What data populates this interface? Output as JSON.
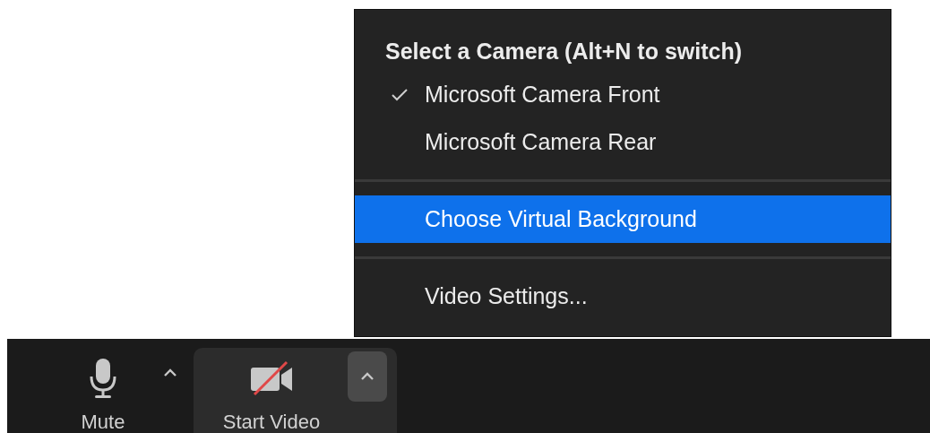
{
  "toolbar": {
    "buttons": [
      {
        "kind": "microphone",
        "label": "Mute",
        "off": false,
        "active": false
      },
      {
        "kind": "camera",
        "label": "Start Video",
        "off": true,
        "active": true
      }
    ]
  },
  "camera_menu": {
    "title": "Select a Camera (Alt+N to switch)",
    "groups": [
      [
        {
          "label": "Microsoft Camera Front",
          "checked": true,
          "selected": false
        },
        {
          "label": "Microsoft Camera Rear",
          "checked": false,
          "selected": false
        }
      ],
      [
        {
          "label": "Choose Virtual Background",
          "checked": false,
          "selected": true
        }
      ],
      [
        {
          "label": "Video Settings...",
          "checked": false,
          "selected": false
        }
      ]
    ]
  }
}
